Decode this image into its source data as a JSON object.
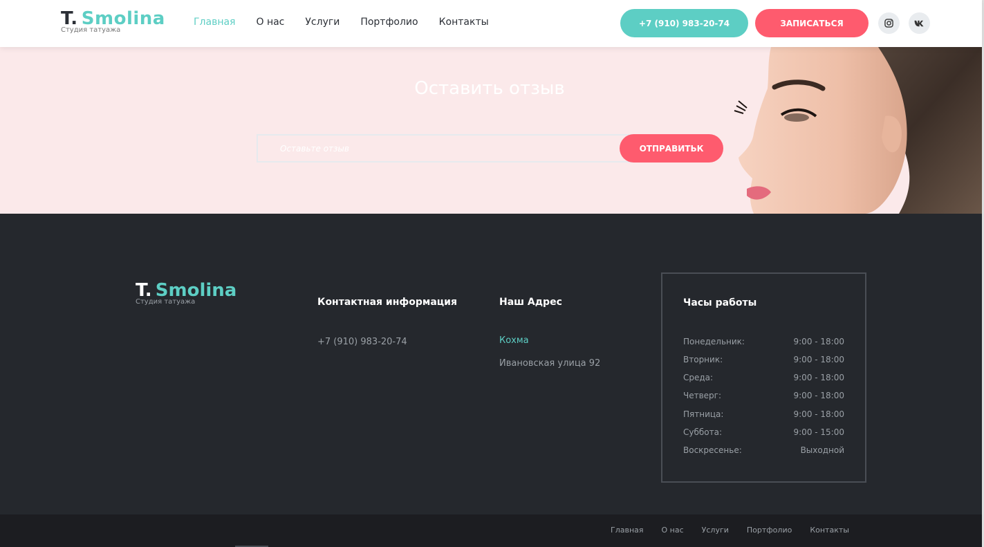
{
  "header": {
    "logo_t": "T.",
    "logo_name": "Smolina",
    "logo_sub": "Студия татуажа",
    "nav": [
      "Главная",
      "О нас",
      "Услуги",
      "Портфолио",
      "Контакты"
    ],
    "phone_button": "+7 (910) 983-20-74",
    "book_button": "ЗАПИСАТЬСЯ",
    "social": [
      "instagram-icon",
      "vk-icon"
    ]
  },
  "review": {
    "title": "Оставить отзыв",
    "input_placeholder": "Оставьте отзыв",
    "send_button": "ОТПРАВИТЬК"
  },
  "footer": {
    "logo_t": "T.",
    "logo_name": "Smolina",
    "logo_sub": "Студия татуажа",
    "contact_title": "Контактная информация",
    "contact_phone": "+7 (910) 983-20-74",
    "address_title": "Наш Адрес",
    "city": "Кохма",
    "street": "Ивановская улица 92",
    "hours_title": "Часы работы",
    "hours": [
      {
        "day": "Понедельник:",
        "time": "9:00 - 18:00"
      },
      {
        "day": "Вторник:",
        "time": "9:00 - 18:00"
      },
      {
        "day": "Среда:",
        "time": "9:00 - 18:00"
      },
      {
        "day": "Четверг:",
        "time": "9:00 - 18:00"
      },
      {
        "day": "Пятница:",
        "time": "9:00 - 18:00"
      },
      {
        "day": "Суббота:",
        "time": "9:00 - 15:00"
      },
      {
        "day": "Воскресенье:",
        "time": "Выходной"
      }
    ]
  },
  "bottom_nav": [
    "Главная",
    "О нас",
    "Услуги",
    "Портфолио",
    "Контакты"
  ],
  "colors": {
    "accent": "#5dcec4",
    "cta": "#fe5b6e",
    "footer_bg": "#25282d",
    "review_bg": "#fbe9ea"
  }
}
